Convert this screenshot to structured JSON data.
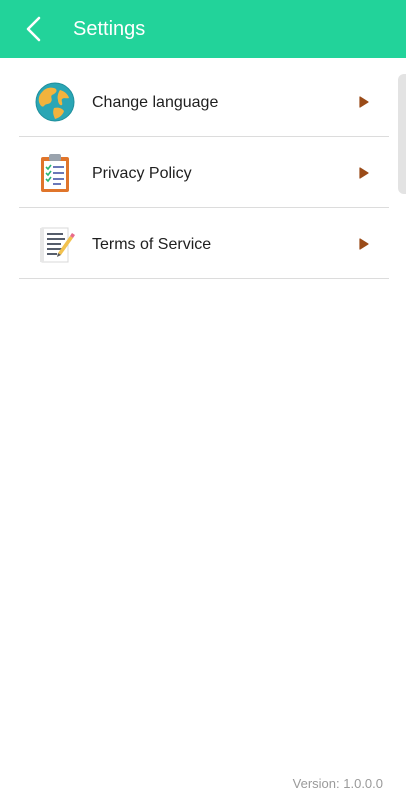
{
  "header": {
    "title": "Settings",
    "back_icon": "chevron-left-icon",
    "background_color": "#22d39a"
  },
  "settings": {
    "items": [
      {
        "label": "Change language",
        "icon": "globe-icon"
      },
      {
        "label": "Privacy Policy",
        "icon": "clipboard-checklist-icon"
      },
      {
        "label": "Terms of Service",
        "icon": "document-pencil-icon"
      }
    ],
    "arrow_icon": "play-arrow-icon",
    "arrow_color": "#9a4b18"
  },
  "footer": {
    "version": "Version: 1.0.0.0"
  }
}
